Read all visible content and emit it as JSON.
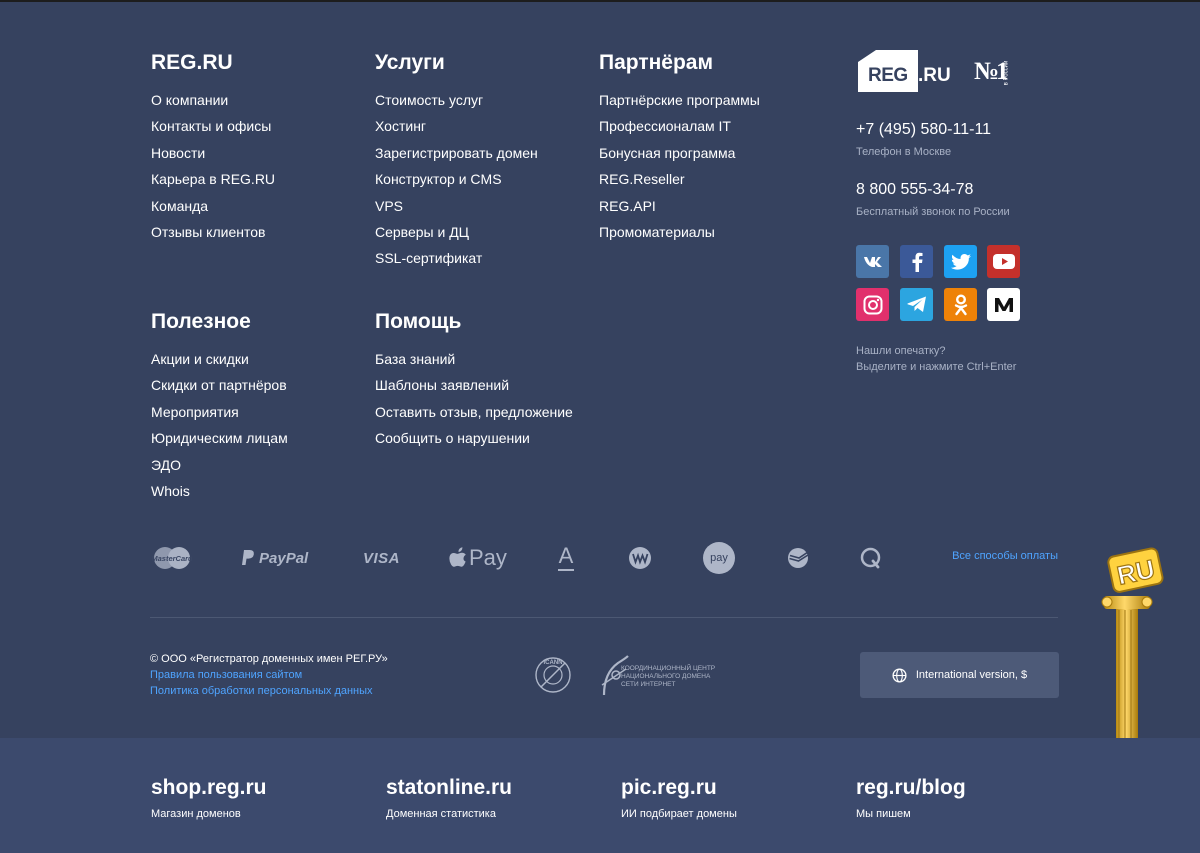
{
  "columns": {
    "regru": {
      "title": "REG.RU",
      "items": [
        "О компании",
        "Контакты и офисы",
        "Новости",
        "Карьера в REG.RU",
        "Команда",
        "Отзывы клиентов"
      ]
    },
    "services": {
      "title": "Услуги",
      "items": [
        "Стоимость услуг",
        "Хостинг",
        "Зарегистрировать домен",
        "Конструктор и CMS",
        "VPS",
        "Серверы и ДЦ",
        "SSL-сертификат"
      ]
    },
    "partners": {
      "title": "Партнёрам",
      "items": [
        "Партнёрские программы",
        "Профессионалам IT",
        "Бонусная программа",
        "REG.Reseller",
        "REG.API",
        "Промоматериалы"
      ]
    },
    "useful": {
      "title": "Полезное",
      "items": [
        "Акции и скидки",
        "Скидки от партнёров",
        "Мероприятия",
        "Юридическим лицам",
        "ЭДО",
        "Whois"
      ]
    },
    "help": {
      "title": "Помощь",
      "items": [
        "База знаний",
        "Шаблоны заявлений",
        "Оставить отзыв, предложение",
        "Сообщить о нарушении"
      ]
    }
  },
  "logo": {
    "text_reg": "REG",
    "text_ru": ".RU",
    "badge_n": "№1",
    "badge_sub": "в России"
  },
  "contacts": {
    "phone_moscow": "+7 (495) 580-11-11",
    "phone_moscow_caption": "Телефон в Москве",
    "phone_free": "8 800 555-34-78",
    "phone_free_caption": "Бесплатный звонок по России"
  },
  "social": [
    {
      "name": "vk",
      "icon": "vk-icon",
      "color": "#4a76a8"
    },
    {
      "name": "facebook",
      "icon": "facebook-icon",
      "color": "#3b5998"
    },
    {
      "name": "twitter",
      "icon": "twitter-icon",
      "color": "#1da1f2"
    },
    {
      "name": "youtube",
      "icon": "youtube-icon",
      "color": "#c4302b"
    },
    {
      "name": "instagram",
      "icon": "instagram-icon",
      "color": "#e1306c"
    },
    {
      "name": "telegram",
      "icon": "telegram-icon",
      "color": "#2ca5e0"
    },
    {
      "name": "odnoklassniki",
      "icon": "odnoklassniki-icon",
      "color": "#ee8208"
    },
    {
      "name": "medium",
      "icon": "medium-icon",
      "color": "#ffffff"
    }
  ],
  "typo": {
    "line1": "Нашли опечатку?",
    "line2": "Выделите и нажмите Ctrl+Enter"
  },
  "payments": {
    "items": [
      "mastercard-icon",
      "paypal-icon",
      "visa-icon",
      "apple-pay-icon",
      "alfa-bank-icon",
      "webmoney-icon",
      "gpay-icon",
      "sberbank-icon",
      "qiwi-icon"
    ],
    "mastercard_label": "MasterCard",
    "paypal_label": "PayPal",
    "visa_label": "VISA",
    "applepay_label": "Pay",
    "alfa_label": "А",
    "gpay_label": "pay",
    "all_label": "Все способы оплаты"
  },
  "legal": {
    "copyright": "© ООО «Регистратор доменных имен РЕГ.РУ»",
    "terms": "Правила пользования сайтом",
    "privacy": "Политика обработки персональных данных",
    "icann_label": "ICANN",
    "cc_label": "КООРДИНАЦИОННЫЙ ЦЕНТР НАЦИОНАЛЬНОГО ДОМЕНА СЕТИ ИНТЕРНЕТ",
    "cc_line1": "КООРДИНАЦИОННЫЙ ЦЕНТР",
    "cc_line2": "НАЦИОНАЛЬНОГО ДОМЕНА",
    "cc_line3": "СЕТИ ИНТЕРНЕТ"
  },
  "intl": {
    "label": "International version, $"
  },
  "statue": {
    "text": "RU"
  },
  "sites": [
    {
      "name": "shop.reg.ru",
      "desc": "Магазин доменов"
    },
    {
      "name": "statonline.ru",
      "desc": "Доменная статистика"
    },
    {
      "name": "pic.reg.ru",
      "desc": "ИИ подбирает домены"
    },
    {
      "name": "reg.ru/blog",
      "desc": "Мы пишем"
    }
  ],
  "colors": {
    "background": "#36425f",
    "bottom_bar": "#3c4a6d",
    "link": "#4fa4ff",
    "muted": "#a8b1c5"
  }
}
